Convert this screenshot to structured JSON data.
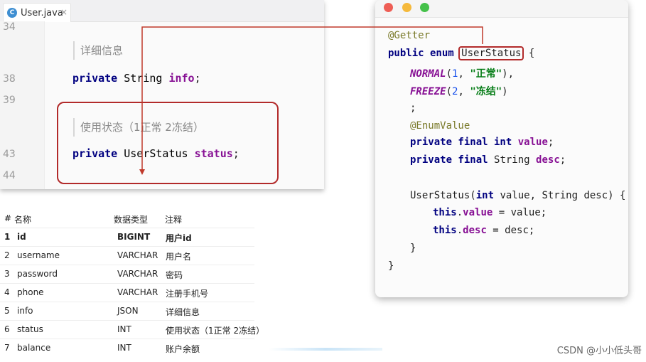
{
  "editor": {
    "tab_label": "User.java",
    "tab_icon_letter": "C",
    "tab_close": "×",
    "line_numbers": [
      "34",
      "38",
      "39",
      "43",
      "44"
    ],
    "doc_info": "详细信息",
    "doc_status": "使用状态（1正常 2冻结）",
    "line_info": {
      "kw": "private",
      "type": "String",
      "name": "info",
      "end": ";"
    },
    "line_status": {
      "kw": "private",
      "type": "UserStatus",
      "name": "status",
      "end": ";"
    }
  },
  "enum_code": {
    "annotation": "@Getter",
    "decl_kw": "public enum",
    "enum_name": "UserStatus",
    "open_brace": "{",
    "const1": {
      "name": "NORMAL",
      "num": "1",
      "str": "\"正常\""
    },
    "const2": {
      "name": "FREEZE",
      "num": "2",
      "str": "\"冻结\""
    },
    "semicolon": ";",
    "annotation2": "@EnumValue",
    "field1": {
      "kw": "private final int",
      "name": "value"
    },
    "field2": {
      "kw": "private final",
      "type": "String",
      "name": "desc"
    },
    "ctor_name": "UserStatus(",
    "ctor_kw_int": "int",
    "ctor_mid": " value, String desc) {",
    "assign1_kw": "this",
    "assign1_name": "value",
    "assign1_rest": " = value;",
    "assign2_kw": "this",
    "assign2_name": "desc",
    "assign2_rest": " = desc;",
    "close_inner": "}",
    "close_outer": "}"
  },
  "table": {
    "headers": [
      "#",
      "名称",
      "数据类型",
      "注释"
    ],
    "rows": [
      {
        "n": "1",
        "name": "id",
        "type": "BIGINT",
        "comment": "用户id"
      },
      {
        "n": "2",
        "name": "username",
        "type": "VARCHAR",
        "comment": "用户名"
      },
      {
        "n": "3",
        "name": "password",
        "type": "VARCHAR",
        "comment": "密码"
      },
      {
        "n": "4",
        "name": "phone",
        "type": "VARCHAR",
        "comment": "注册手机号"
      },
      {
        "n": "5",
        "name": "info",
        "type": "JSON",
        "comment": "详细信息"
      },
      {
        "n": "6",
        "name": "status",
        "type": "INT",
        "comment": "使用状态（1正常 2冻结）"
      },
      {
        "n": "7",
        "name": "balance",
        "type": "INT",
        "comment": "账户余额"
      }
    ]
  },
  "watermark": "CSDN @小小低头哥",
  "colors": {
    "highlight": "#b22a2a",
    "keyword": "#0033b3",
    "field": "#871094",
    "string": "#067d17"
  }
}
